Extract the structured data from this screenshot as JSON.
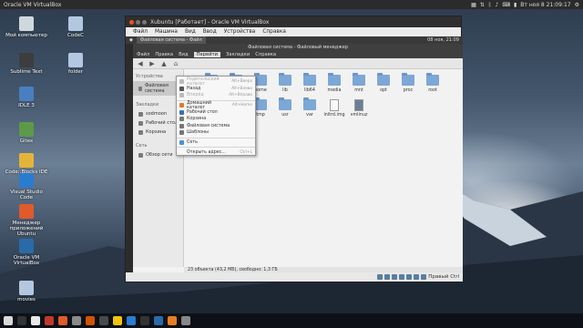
{
  "topbar": {
    "title": "Oracle VM VirtualBox",
    "datetime": "Вт ноя 8 21:09:17",
    "tray_icons": [
      "dropbox-icon",
      "network-icon",
      "bluetooth-icon",
      "volume-icon",
      "keyboard-icon",
      "battery-icon"
    ]
  },
  "desktop": {
    "icons": [
      {
        "id": "my-computer",
        "label": "Мой компьютер",
        "color": "#cfd8dc"
      },
      {
        "id": "codec",
        "label": "CodeC",
        "color": "#b3c7e0"
      },
      {
        "id": "sublime",
        "label": "Sublime Text",
        "color": "#3d3d3d"
      },
      {
        "id": "folder",
        "label": "folder",
        "color": "#b3c7e0"
      },
      {
        "id": "idle",
        "label": "IDLE 3",
        "color": "#4a7fbf"
      },
      {
        "id": "gitex",
        "label": "Gitex",
        "color": "#5c9a4a"
      },
      {
        "id": "code-blocks",
        "label": "Code::Blocks IDE",
        "color": "#e4b43a"
      },
      {
        "id": "vscode",
        "label": "Visual Studio Code",
        "color": "#2a7ccf"
      },
      {
        "id": "app-manager",
        "label": "Менеджер приложений Ubuntu",
        "color": "#e05a2b"
      },
      {
        "id": "virtualbox",
        "label": "Oracle VM VirtualBox",
        "color": "#2a6aa8"
      },
      {
        "id": "movies",
        "label": "movies",
        "color": "#b3c7e0"
      }
    ]
  },
  "vbox": {
    "title": "Xubuntu [Работает] - Oracle VM VirtualBox",
    "menu": [
      "Файл",
      "Машина",
      "Вид",
      "Ввод",
      "Устройства",
      "Справка"
    ],
    "status_right": "Правый Ctrl"
  },
  "guest": {
    "tab_label": "Файловая система - Файл",
    "time": "08 ноя, 21:09",
    "fm_title": "Файловая система - Файловый менеджер",
    "fm_menu": [
      "Файл",
      "Правка",
      "Вид",
      "Перейти",
      "Закладки",
      "Справка"
    ],
    "fm_menu_active_index": 3,
    "sidebar": {
      "sections": [
        {
          "header": "Устройства",
          "items": [
            {
              "label": "Файловая система",
              "selected": true
            }
          ]
        },
        {
          "header": "Закладки",
          "items": [
            {
              "label": "sodmoon"
            },
            {
              "label": "Рабочий стол"
            },
            {
              "label": "Корзина"
            }
          ]
        },
        {
          "header": "Сеть",
          "items": [
            {
              "label": "Обзор сети"
            }
          ]
        }
      ]
    },
    "files_row1": [
      "dev",
      "etc",
      "home",
      "lib",
      "lib64",
      "media",
      "mnt",
      "opt",
      "proc",
      "root"
    ],
    "files_row2": [
      "srv",
      "sys",
      "tmp",
      "usr",
      "var",
      "initrd.img",
      "vmlinuz"
    ],
    "status": "23 объекта (43,2 МБ), свободно: 1,3 ГБ",
    "dropdown": {
      "items": [
        {
          "label": "Родительский каталог",
          "shortcut": "Alt+Вверх",
          "disabled": true,
          "color": "#bbbbbb"
        },
        {
          "label": "Назад",
          "shortcut": "Alt+Влево",
          "disabled": false,
          "color": "#555555"
        },
        {
          "label": "Вперёд",
          "shortcut": "Alt+Вправо",
          "disabled": true,
          "color": "#bbbbbb"
        },
        {
          "separator": true
        },
        {
          "label": "Домашний каталог",
          "shortcut": "Alt+Home",
          "disabled": false,
          "color": "#e07a2b"
        },
        {
          "label": "Рабочий стол",
          "shortcut": "",
          "disabled": false,
          "color": "#3a6fb0"
        },
        {
          "label": "Корзина",
          "shortcut": "",
          "disabled": false,
          "color": "#777777"
        },
        {
          "label": "Файловая система",
          "shortcut": "",
          "disabled": false,
          "color": "#777777"
        },
        {
          "label": "Шаблоны",
          "shortcut": "",
          "disabled": false,
          "color": "#777777"
        },
        {
          "separator": true
        },
        {
          "label": "Сеть",
          "shortcut": "",
          "disabled": false,
          "color": "#4a90d9"
        },
        {
          "separator": true
        },
        {
          "label": "Открыть адрес...",
          "shortcut": "Ctrl+L",
          "disabled": false,
          "color": ""
        }
      ]
    }
  },
  "taskbar": {
    "icons": [
      {
        "name": "files-icon",
        "color": "#d9d9d9"
      },
      {
        "name": "terminal-icon",
        "color": "#333333"
      },
      {
        "name": "text-editor-icon",
        "color": "#e8e8e8"
      },
      {
        "name": "system-monitor-icon",
        "color": "#c0392b"
      },
      {
        "name": "software-center-icon",
        "color": "#e05a2b"
      },
      {
        "name": "settings-icon",
        "color": "#8a8a8a"
      },
      {
        "name": "media-player-icon",
        "color": "#d35400"
      },
      {
        "name": "sublime-icon",
        "color": "#4a4a4a"
      },
      {
        "name": "python-icon",
        "color": "#f1c40f"
      },
      {
        "name": "code-icon",
        "color": "#2a7ccf"
      },
      {
        "name": "terminal2-icon",
        "color": "#333333"
      },
      {
        "name": "virtualbox-icon",
        "color": "#2a6aa8"
      },
      {
        "name": "browser-icon",
        "color": "#e67e22"
      },
      {
        "name": "trash-icon",
        "color": "#888888"
      }
    ]
  }
}
